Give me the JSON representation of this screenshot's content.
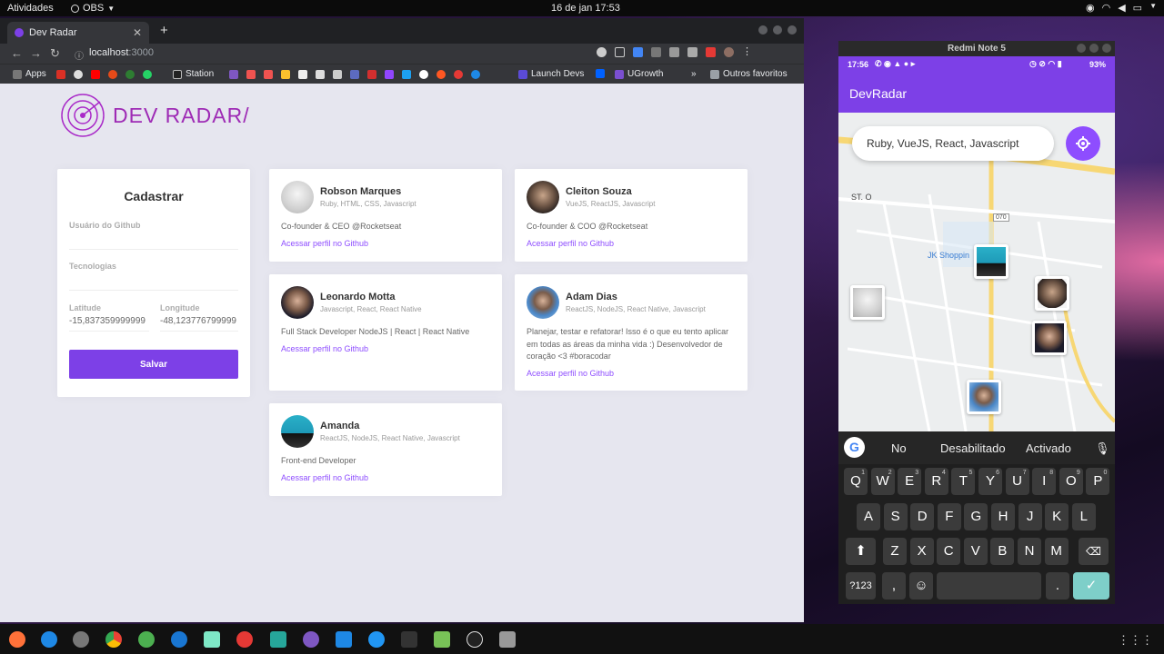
{
  "system": {
    "activities": "Atividades",
    "obs_label": "OBS",
    "clock": "16 de jan  17:53"
  },
  "browser": {
    "tab_title": "Dev Radar",
    "url": "localhost",
    "url_port": ":3000",
    "bookmarks": [
      {
        "label": "Apps",
        "color": "#5f6368"
      },
      {
        "label": "Station",
        "color": "#222"
      },
      {
        "label": "Launch Devs",
        "color": "#5b4bd6"
      },
      {
        "label": "UGrowth",
        "color": "#7a4fd0"
      },
      {
        "label": "Outros favoritos",
        "color": "#9aa0a6"
      }
    ]
  },
  "app": {
    "logo_text": "DEV RADAR/",
    "colors": {
      "primary": "#7d40e7",
      "link": "#8e4dff",
      "logo": "#9e2bb5"
    },
    "form": {
      "title": "Cadastrar",
      "github_label": "Usuário do Github",
      "github_value": "",
      "techs_label": "Tecnologias",
      "techs_value": "",
      "lat_label": "Latitude",
      "lat_value": "-15,837359999999",
      "lng_label": "Longitude",
      "lng_value": "-48,123776799999",
      "save_label": "Salvar"
    },
    "devs": [
      {
        "name": "Robson Marques",
        "techs": "Ruby, HTML, CSS, Javascript",
        "bio": "Co-founder & CEO @Rocketseat",
        "link": "Acessar perfil no Github"
      },
      {
        "name": "Cleiton Souza",
        "techs": "VueJS, ReactJS, Javascript",
        "bio": "Co-founder & COO @Rocketseat",
        "link": "Acessar perfil no Github"
      },
      {
        "name": "Leonardo Motta",
        "techs": "Javascript, React, React Native",
        "bio": "Full Stack Developer NodeJS | React | React Native",
        "link": "Acessar perfil no Github"
      },
      {
        "name": "Adam Dias",
        "techs": "ReactJS, NodeJS, React Native, Javascript",
        "bio": "Planejar, testar e refatorar! Isso é o que eu tento aplicar em todas as áreas da minha vida :) Desenvolvedor de coração <3 #boracodar",
        "link": "Acessar perfil no Github"
      },
      {
        "name": "Amanda",
        "techs": "ReactJS, NodeJS, React Native, Javascript",
        "bio": "Front-end Developer",
        "link": "Acessar perfil no Github"
      }
    ]
  },
  "phone": {
    "device_title": "Redmi Note 5",
    "status_time": "17:56",
    "battery": "93%",
    "app_title": "DevRadar",
    "search_value": "Ruby, VueJS, React, Javascript",
    "map_labels": {
      "street1": "ST. O",
      "mall": "JK Shoppin",
      "road": "070"
    },
    "suggestions": [
      "No",
      "Desabilitado",
      "Activado"
    ],
    "keyboard": {
      "row1": [
        "Q",
        "W",
        "E",
        "R",
        "T",
        "Y",
        "U",
        "I",
        "O",
        "P"
      ],
      "row1_sup": [
        "1",
        "2",
        "3",
        "4",
        "5",
        "6",
        "7",
        "8",
        "9",
        "0"
      ],
      "row2": [
        "A",
        "S",
        "D",
        "F",
        "G",
        "H",
        "J",
        "K",
        "L"
      ],
      "row3": [
        "Z",
        "X",
        "C",
        "V",
        "B",
        "N",
        "M"
      ],
      "sym_label": "?123",
      "comma": ",",
      "period": "."
    }
  }
}
